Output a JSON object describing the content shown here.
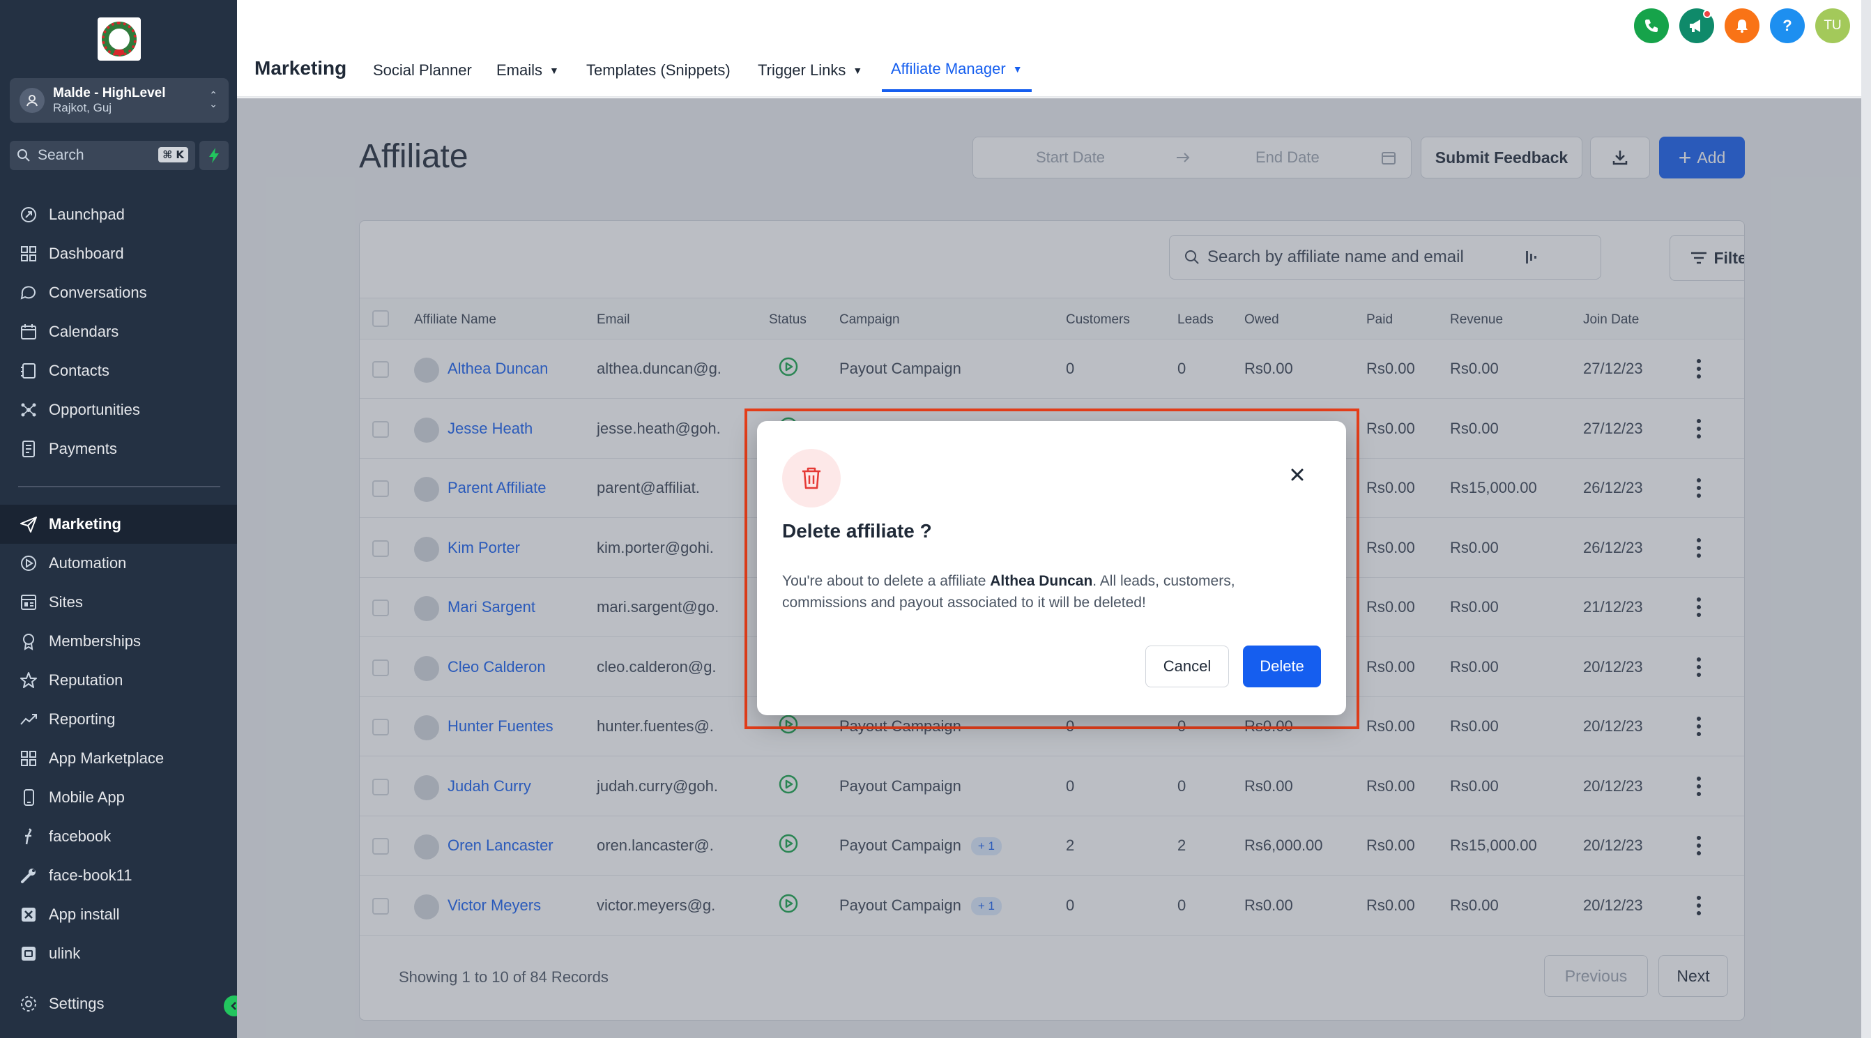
{
  "sidebar": {
    "account": {
      "name": "Malde - HighLevel",
      "location": "Rajkot, Guj"
    },
    "search": {
      "label": "Search",
      "shortcut": "⌘ K"
    },
    "items": [
      {
        "label": "Launchpad",
        "icon": "launchpad-icon"
      },
      {
        "label": "Dashboard",
        "icon": "dashboard-icon"
      },
      {
        "label": "Conversations",
        "icon": "chat-icon"
      },
      {
        "label": "Calendars",
        "icon": "calendar-icon"
      },
      {
        "label": "Contacts",
        "icon": "contacts-icon"
      },
      {
        "label": "Opportunities",
        "icon": "opportunities-icon"
      },
      {
        "label": "Payments",
        "icon": "payments-icon"
      }
    ],
    "items2": [
      {
        "label": "Marketing",
        "icon": "send-icon"
      },
      {
        "label": "Automation",
        "icon": "automation-icon"
      },
      {
        "label": "Sites",
        "icon": "sites-icon"
      },
      {
        "label": "Memberships",
        "icon": "memberships-icon"
      },
      {
        "label": "Reputation",
        "icon": "star-icon"
      },
      {
        "label": "Reporting",
        "icon": "reporting-icon"
      },
      {
        "label": "App Marketplace",
        "icon": "grid-icon"
      },
      {
        "label": "Mobile App",
        "icon": "mobile-icon"
      },
      {
        "label": "facebook",
        "icon": "facebook-icon"
      },
      {
        "label": "face-book11",
        "icon": "wrench-icon"
      },
      {
        "label": "App install",
        "icon": "x-box-icon"
      },
      {
        "label": "ulink",
        "icon": "link-box-icon"
      }
    ],
    "settings": "Settings"
  },
  "header": {
    "section": "Marketing",
    "tabs": [
      {
        "label": "Social Planner"
      },
      {
        "label": "Emails"
      },
      {
        "label": "Templates (Snippets)"
      },
      {
        "label": "Trigger Links"
      },
      {
        "label": "Affiliate Manager"
      }
    ],
    "avatar_initials": "TU",
    "help": "?"
  },
  "page": {
    "title": "Affiliate",
    "start_date": "Start Date",
    "end_date": "End Date",
    "submit_feedback": "Submit Feedback",
    "add": "Add",
    "search_placeholder": "Search by affiliate name and email",
    "filters": "Filters"
  },
  "table": {
    "columns": [
      "Affiliate Name",
      "Email",
      "Status",
      "Campaign",
      "Customers",
      "Leads",
      "Owed",
      "Paid",
      "Revenue",
      "Join Date"
    ],
    "rows": [
      {
        "name": "Althea Duncan",
        "email": "althea.duncan@g.",
        "campaign": "Payout Campaign",
        "extra": "",
        "customers": "0",
        "leads": "0",
        "owed": "Rs0.00",
        "paid": "Rs0.00",
        "revenue": "Rs0.00",
        "join": "27/12/23"
      },
      {
        "name": "Jesse Heath",
        "email": "jesse.heath@goh.",
        "campaign": "",
        "extra": "",
        "customers": "",
        "leads": "",
        "owed": "",
        "paid": "Rs0.00",
        "revenue": "Rs0.00",
        "join": "27/12/23"
      },
      {
        "name": "Parent Affiliate",
        "email": "parent@affiliat.",
        "campaign": "",
        "extra": "",
        "customers": "",
        "leads": "",
        "owed": "",
        "paid": "Rs0.00",
        "revenue": "Rs15,000.00",
        "join": "26/12/23"
      },
      {
        "name": "Kim Porter",
        "email": "kim.porter@gohi.",
        "campaign": "",
        "extra": "",
        "customers": "",
        "leads": "",
        "owed": "",
        "paid": "Rs0.00",
        "revenue": "Rs0.00",
        "join": "26/12/23"
      },
      {
        "name": "Mari Sargent",
        "email": "mari.sargent@go.",
        "campaign": "",
        "extra": "",
        "customers": "",
        "leads": "",
        "owed": "",
        "paid": "Rs0.00",
        "revenue": "Rs0.00",
        "join": "21/12/23"
      },
      {
        "name": "Cleo Calderon",
        "email": "cleo.calderon@g.",
        "campaign": "",
        "extra": "",
        "customers": "",
        "leads": "",
        "owed": "",
        "paid": "Rs0.00",
        "revenue": "Rs0.00",
        "join": "20/12/23"
      },
      {
        "name": "Hunter Fuentes",
        "email": "hunter.fuentes@.",
        "campaign": "Payout Campaign",
        "extra": "",
        "customers": "0",
        "leads": "0",
        "owed": "Rs0.00",
        "paid": "Rs0.00",
        "revenue": "Rs0.00",
        "join": "20/12/23"
      },
      {
        "name": "Judah Curry",
        "email": "judah.curry@goh.",
        "campaign": "Payout Campaign",
        "extra": "",
        "customers": "0",
        "leads": "0",
        "owed": "Rs0.00",
        "paid": "Rs0.00",
        "revenue": "Rs0.00",
        "join": "20/12/23"
      },
      {
        "name": "Oren Lancaster",
        "email": "oren.lancaster@.",
        "campaign": "Payout Campaign",
        "extra": "+ 1",
        "customers": "2",
        "leads": "2",
        "owed": "Rs6,000.00",
        "paid": "Rs0.00",
        "revenue": "Rs15,000.00",
        "join": "20/12/23"
      },
      {
        "name": "Victor Meyers",
        "email": "victor.meyers@g.",
        "campaign": "Payout Campaign",
        "extra": "+ 1",
        "customers": "0",
        "leads": "0",
        "owed": "Rs0.00",
        "paid": "Rs0.00",
        "revenue": "Rs0.00",
        "join": "20/12/23"
      }
    ],
    "footer": "Showing 1 to 10 of 84 Records",
    "previous": "Previous",
    "next": "Next"
  },
  "modal": {
    "title": "Delete affiliate ?",
    "body_prefix": "You're about to delete a affiliate ",
    "body_name": "Althea Duncan",
    "body_suffix": ". All leads, customers, commissions and payout associated to it will be deleted!",
    "cancel": "Cancel",
    "delete": "Delete"
  },
  "colors": {
    "primary": "#155eef",
    "sidebar": "#243143",
    "highlight": "#e53e1a",
    "danger": "#ef4444",
    "success": "#16a34a"
  }
}
